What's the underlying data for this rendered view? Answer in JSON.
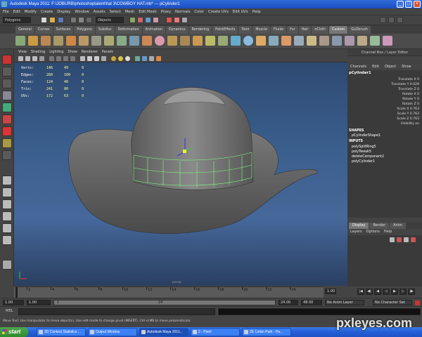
{
  "window": {
    "title": "Autodesk Maya 2011: F:\\JOBURB\\photoshoptalent\\hat 3\\COWBOY HAT.mb*  ---  pCylinder1",
    "minimize": "_",
    "maximize": "□",
    "close": "×"
  },
  "menu": [
    "File",
    "Edit",
    "Modify",
    "Create",
    "Display",
    "Window",
    "Assets",
    "Select",
    "Mesh",
    "Edit Mesh",
    "Proxy",
    "Normals",
    "Color",
    "Create UVs",
    "Edit UVs",
    "Help"
  ],
  "statusline": {
    "mode": "Polygons",
    "select_field": "Objects"
  },
  "shelf_tabs": [
    "General",
    "Curves",
    "Surfaces",
    "Polygons",
    "Subdivs",
    "Deformation",
    "Animation",
    "Dynamics",
    "Rendering",
    "PaintEffects",
    "Toon",
    "Muscle",
    "Fluids",
    "Fur",
    "Hair",
    "nCloth",
    "Custom",
    "GoZbrush"
  ],
  "shelf_active_tab": "Custom",
  "viewport": {
    "menu": [
      "View",
      "Shading",
      "Lighting",
      "Show",
      "Renderer",
      "Panels"
    ],
    "hud": [
      {
        "label": "Verts:",
        "a": "146",
        "b": "49",
        "c": "0"
      },
      {
        "label": "Edges:",
        "a": "260",
        "b": "100",
        "c": "0"
      },
      {
        "label": "Faces:",
        "a": "124",
        "b": "40",
        "c": "0"
      },
      {
        "label": "Tris:",
        "a": "241",
        "b": "80",
        "c": "0"
      },
      {
        "label": "UVs:",
        "a": "172",
        "b": "63",
        "c": "0"
      }
    ],
    "camera": "persp"
  },
  "channel_box": {
    "header": "Channel Box / Layer Editor",
    "menu": [
      "Channels",
      "Edit",
      "Object",
      "Show"
    ],
    "object": "pCylinder1",
    "attributes": [
      "Translate X 0",
      "Translate Y 0.029",
      "Translate Z 0",
      "Rotate X 0",
      "Rotate Y 0",
      "Rotate Z 0",
      "Scale X 0.763",
      "Scale Y 0.763",
      "Scale Z 0.763",
      "Visibility on"
    ],
    "shapes_label": "SHAPES",
    "shape": "pCylinderShape1",
    "inputs_label": "INPUTS",
    "inputs": [
      "polySplitRing5",
      "polyTweak5",
      "deleteComponent2",
      "polyCylinder1"
    ]
  },
  "layer_editor": {
    "tabs": [
      "Display",
      "Render",
      "Anim"
    ],
    "active_tab": "Display",
    "menu": [
      "Layers",
      "Options",
      "Help"
    ]
  },
  "timeline": {
    "ticks": [
      "2",
      "4",
      "6",
      "8",
      "10",
      "12",
      "14",
      "16",
      "18",
      "20",
      "22",
      "24"
    ],
    "current_frame": "1.00"
  },
  "range": {
    "start": "1.00",
    "start_inner": "1.00",
    "range_start": "1",
    "range_end": "24",
    "end_inner": "24.00",
    "end": "48.00",
    "anim_layer": "No Anim Layer",
    "char_set": "No Character Set"
  },
  "command": {
    "mel": "MEL"
  },
  "helpline": "Move Tool: Use manipulator to move object(s). Use edit mode to change pivot (INSERT). Ctrl+LMB to move perpendicular.",
  "taskbar": {
    "start": "start",
    "items": [
      "3D Contest Statistics ...",
      "Output Window",
      "Autodesk Maya 2011...",
      "2 - Paint",
      "ZE Linkin Park - Pa..."
    ]
  },
  "watermark": "pxleyes.com",
  "colors": {
    "accent": "#2f6ad9",
    "viewport_bg": "#3b5f8e",
    "selection_green": "#7cff7c",
    "hud_value": "#ffff9a"
  }
}
